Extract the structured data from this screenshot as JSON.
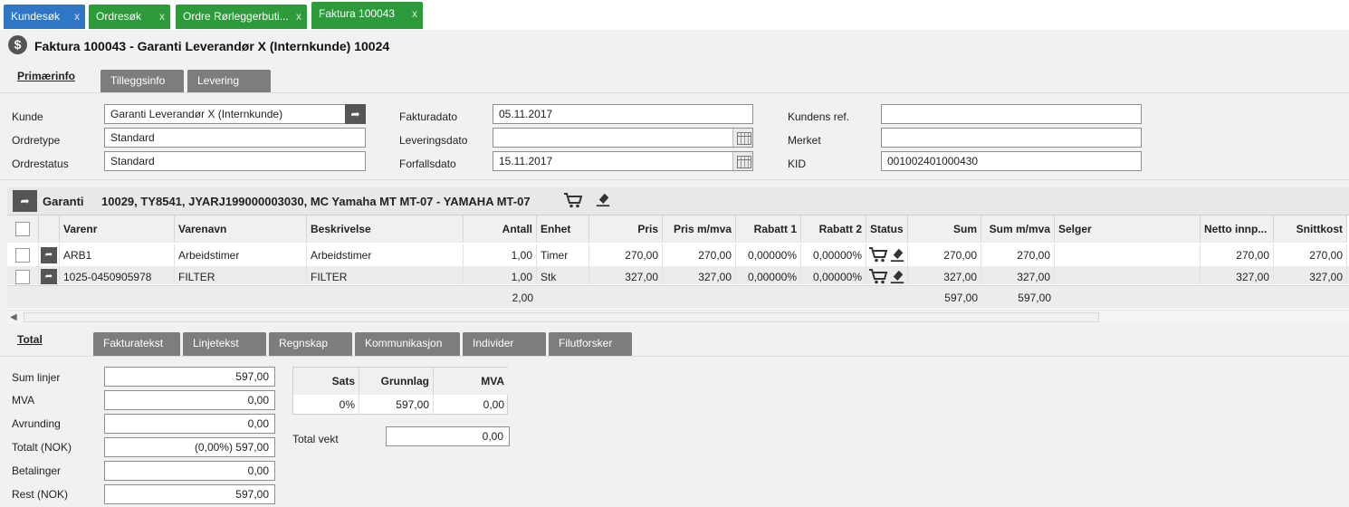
{
  "top_tabs": [
    {
      "label": "Kundesøk",
      "close": "x"
    },
    {
      "label": "Ordresøk",
      "close": "x"
    },
    {
      "label": "Ordre Rørleggerbuti...",
      "close": "x"
    },
    {
      "label": "Faktura 100043",
      "close": "x"
    }
  ],
  "header": {
    "title": "Faktura 100043 - Garanti Leverandør X (Internkunde) 10024"
  },
  "sub_tabs": [
    "Primærinfo",
    "Tilleggsinfo",
    "Levering"
  ],
  "form": {
    "kunde_label": "Kunde",
    "kunde_value": "Garanti Leverandør X (Internkunde)",
    "ordretype_label": "Ordretype",
    "ordretype_value": "Standard",
    "ordrestatus_label": "Ordrestatus",
    "ordrestatus_value": "Standard",
    "fakturadato_label": "Fakturadato",
    "fakturadato_value": "05.11.2017",
    "leveringsdato_label": "Leveringsdato",
    "leveringsdato_value": "",
    "forfallsdato_label": "Forfallsdato",
    "forfallsdato_value": "15.11.2017",
    "kundensref_label": "Kundens ref.",
    "kundensref_value": "",
    "merket_label": "Merket",
    "merket_value": "",
    "kid_label": "KID",
    "kid_value": "001002401000430"
  },
  "lines": {
    "group_name": "Garanti",
    "group_desc": "10029, TY8541, JYARJ199000003030, MC Yamaha MT MT-07 - YAMAHA MT-07",
    "columns": [
      "Varenr",
      "Varenavn",
      "Beskrivelse",
      "Antall",
      "Enhet",
      "Pris",
      "Pris m/mva",
      "Rabatt 1",
      "Rabatt 2",
      "Status",
      "Sum",
      "Sum m/mva",
      "Selger",
      "Netto innp...",
      "Snittkost"
    ],
    "rows": [
      {
        "varenr": "ARB1",
        "varenavn": "Arbeidstimer",
        "beskrivelse": "Arbeidstimer",
        "antall": "1,00",
        "enhet": "Timer",
        "pris": "270,00",
        "pris_mva": "270,00",
        "rabatt1": "0,00000%",
        "rabatt2": "0,00000%",
        "sum": "270,00",
        "sum_mva": "270,00",
        "selger": "",
        "netto": "270,00",
        "snittkost": "270,00"
      },
      {
        "varenr": "1025-0450905978",
        "varenavn": "FILTER",
        "beskrivelse": "FILTER",
        "antall": "1,00",
        "enhet": "Stk",
        "pris": "327,00",
        "pris_mva": "327,00",
        "rabatt1": "0,00000%",
        "rabatt2": "0,00000%",
        "sum": "327,00",
        "sum_mva": "327,00",
        "selger": "",
        "netto": "327,00",
        "snittkost": "327,00"
      }
    ],
    "totals": {
      "antall": "2,00",
      "sum": "597,00",
      "sum_mva": "597,00"
    }
  },
  "bottom_tabs": [
    "Total",
    "Fakturatekst",
    "Linjetekst",
    "Regnskap",
    "Kommunikasjon",
    "Individer",
    "Filutforsker"
  ],
  "totals": {
    "sum_linjer_label": "Sum linjer",
    "sum_linjer": "597,00",
    "mva_label": "MVA",
    "mva": "0,00",
    "avrunding_label": "Avrunding",
    "avrunding": "0,00",
    "totalt_label": "Totalt (NOK)",
    "totalt": "(0,00%) 597,00",
    "betalinger_label": "Betalinger",
    "betalinger": "0,00",
    "rest_label": "Rest (NOK)",
    "rest": "597,00"
  },
  "mva_table": {
    "columns": [
      "Sats",
      "Grunnlag",
      "MVA"
    ],
    "row": [
      "0%",
      "597,00",
      "0,00"
    ]
  },
  "total_vekt_label": "Total vekt",
  "total_vekt": "0,00"
}
